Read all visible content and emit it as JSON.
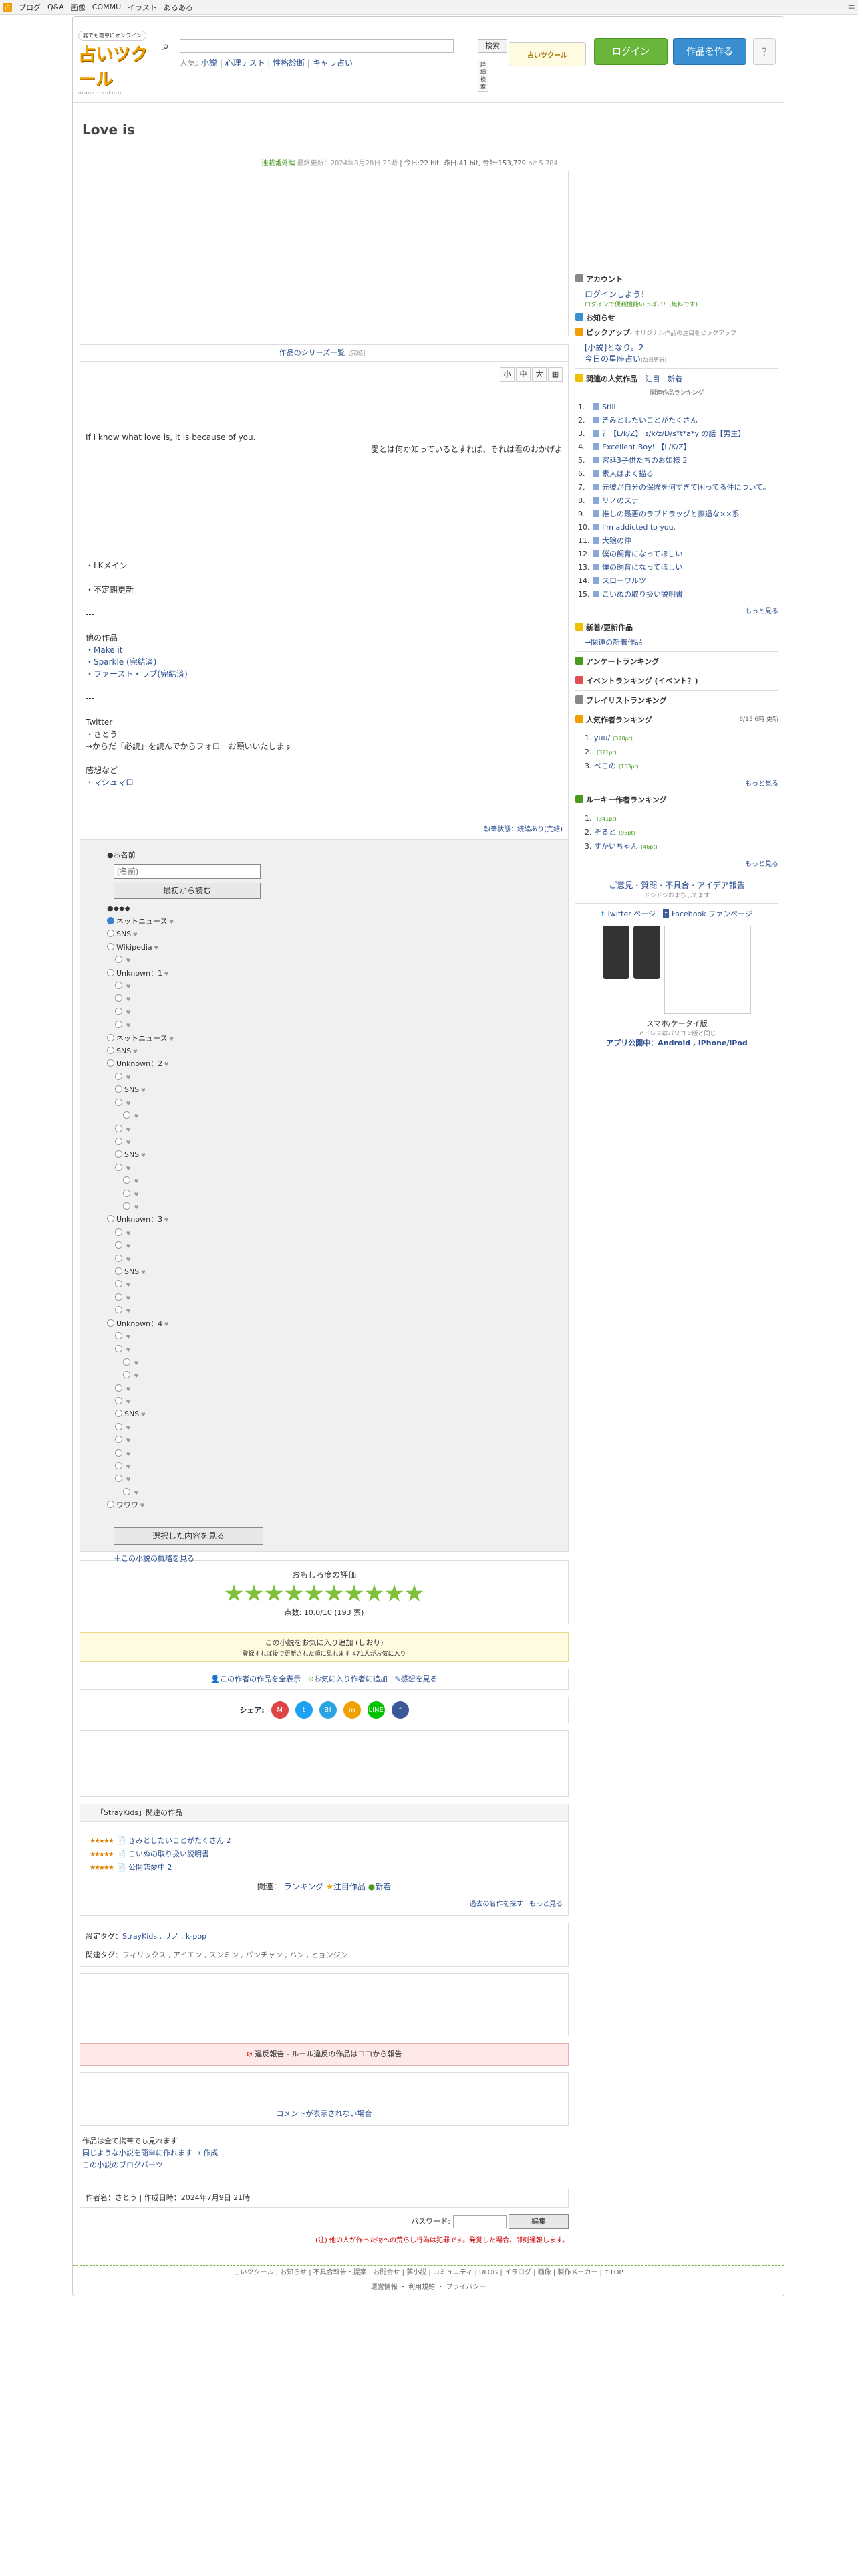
{
  "topnav": {
    "items": [
      "ブログ",
      "Q&A",
      "画像",
      "COMMU",
      "イラスト",
      "あるある"
    ]
  },
  "header": {
    "tag": "誰でも簡単にオンライン",
    "name": "占いツクール",
    "sub": "uranai-tsukuru",
    "search_btn": "検索",
    "popular_label": "人気:",
    "popular": [
      "小説",
      "心理テスト",
      "性格診断",
      "キャラ占い"
    ],
    "adv": "詳細検索",
    "banner": "占いツクール",
    "login": "ログイン",
    "create": "作品を作る"
  },
  "title": "Love is",
  "meta": {
    "status": "連載番外編",
    "updated": "最終更新：2024年8月28日 23時",
    "today": "今日:22 hit,",
    "yesterday": "昨日:41 hit,",
    "total": "合計:153,729 hit",
    "fav": "5 784"
  },
  "series_label": "作品のシリーズ一覧",
  "series_note": "［完結］",
  "font_sizes": [
    "小",
    "中",
    "大"
  ],
  "body_lines": [
    "If I know what love is, it is because of you.",
    "愛とは何か知っているとすれば、それは君のおかげよ",
    "---",
    "・LKメイン",
    "・不定期更新",
    "---",
    "他の作品",
    "・Make it",
    "・Sparkle (完結済)",
    "・ファースト・ラブ(完結済)",
    "---",
    "Twitter",
    "・さとう",
    "→からだ「必読」を読んでからフォローお願いいたします",
    "感想など",
    "・マシュマロ"
  ],
  "body_foot": "執筆状態：続編あり(完結)",
  "game": {
    "name_label": "●お名前",
    "name_ph": "(名前)",
    "read_first": "最初から読む",
    "tree_label": "●◆◆◆",
    "select_btn": "選択した内容を見る",
    "overview": "＋この小説の概略を見る",
    "tree": [
      {
        "d": 0,
        "t": "ネットニュース",
        "s": 1
      },
      {
        "d": 0,
        "t": "SNS"
      },
      {
        "d": 0,
        "t": "Wikipedia"
      },
      {
        "d": 1,
        "t": ""
      },
      {
        "d": 0,
        "t": "Unknown：1"
      },
      {
        "d": 1,
        "t": ""
      },
      {
        "d": 1,
        "t": ""
      },
      {
        "d": 1,
        "t": ""
      },
      {
        "d": 1,
        "t": ""
      },
      {
        "d": 0,
        "t": "ネットニュース"
      },
      {
        "d": 0,
        "t": "SNS"
      },
      {
        "d": 0,
        "t": "Unknown：2"
      },
      {
        "d": 1,
        "t": ""
      },
      {
        "d": 1,
        "t": "SNS"
      },
      {
        "d": 1,
        "t": ""
      },
      {
        "d": 2,
        "t": ""
      },
      {
        "d": 1,
        "t": ""
      },
      {
        "d": 1,
        "t": ""
      },
      {
        "d": 1,
        "t": "SNS"
      },
      {
        "d": 1,
        "t": ""
      },
      {
        "d": 2,
        "t": ""
      },
      {
        "d": 2,
        "t": ""
      },
      {
        "d": 2,
        "t": ""
      },
      {
        "d": 0,
        "t": "Unknown：3"
      },
      {
        "d": 1,
        "t": ""
      },
      {
        "d": 1,
        "t": ""
      },
      {
        "d": 1,
        "t": ""
      },
      {
        "d": 1,
        "t": "SNS"
      },
      {
        "d": 1,
        "t": ""
      },
      {
        "d": 1,
        "t": ""
      },
      {
        "d": 1,
        "t": ""
      },
      {
        "d": 0,
        "t": "Unknown：4"
      },
      {
        "d": 1,
        "t": ""
      },
      {
        "d": 1,
        "t": ""
      },
      {
        "d": 2,
        "t": ""
      },
      {
        "d": 2,
        "t": ""
      },
      {
        "d": 1,
        "t": ""
      },
      {
        "d": 1,
        "t": ""
      },
      {
        "d": 1,
        "t": "SNS"
      },
      {
        "d": 1,
        "t": ""
      },
      {
        "d": 1,
        "t": ""
      },
      {
        "d": 1,
        "t": ""
      },
      {
        "d": 1,
        "t": ""
      },
      {
        "d": 1,
        "t": ""
      },
      {
        "d": 2,
        "t": ""
      },
      {
        "d": 0,
        "t": "ワワワ"
      }
    ]
  },
  "rating": {
    "label": "おもしろ度の評価",
    "score": "点数: 10.0/10 (193 票)",
    "value": 10
  },
  "fav": {
    "line1": "この小説をお気に入り追加 (しおり)",
    "line2": "登録すれば後で更新された順に見れます 471人がお気に入り"
  },
  "actions": [
    "この作者の作品を全表示",
    "お気に入り作者に追加",
    "感想を見る"
  ],
  "share": {
    "label": "シェア:",
    "items": [
      {
        "t": "M",
        "c": "#d44"
      },
      {
        "t": "t",
        "c": "#1da1f2"
      },
      {
        "t": "B!",
        "c": "#2aa3e0"
      },
      {
        "t": "m",
        "c": "#f0a000"
      },
      {
        "t": "LINE",
        "c": "#00c300"
      },
      {
        "t": "f",
        "c": "#3b5998"
      }
    ]
  },
  "related": {
    "header": "「StrayKids」関連の作品",
    "items": [
      "きみとしたいことがたくさん 2",
      "こいぬの取り扱い説明書",
      "公開恋愛中 2"
    ],
    "links": [
      "ランキング",
      "注目作品",
      "新着"
    ],
    "past": "過去の名作を探す",
    "more": "もっと見る"
  },
  "tags": {
    "set_label": "設定タグ：",
    "set": "StrayKids , リノ , k-pop",
    "rel_label": "関連タグ：",
    "rel": "フィリックス , アイエン , スンミン , バンチャン , ハン , ヒョンジン"
  },
  "report": "違反報告 - ルール違反の作品はココから報告",
  "comment": "コメントが表示されない場合",
  "links": [
    "作品は全て携帯でも見れます",
    "同じような小説を簡単に作れます → 作成",
    "この小説のブログパーツ"
  ],
  "author": "作者名：さとう | 作成日時：2024年7月9日 21時",
  "password": {
    "label": "パスワード:",
    "btn": "編集"
  },
  "warning": "(注) 他の人が作った物への荒らし行為は犯罪です。発覚した場合、即刻通報します。",
  "sidebar": {
    "account": "アカウント",
    "login_msg": "ログインしよう！",
    "login_sub": "ログインで便利機能いっぱい！(無料です)",
    "notice": "お知らせ",
    "pickup": "ピックアップ",
    "pickup_sub": "- オリジナル作品の注目をピックアップ",
    "pickup_item": "[小説]となり。2",
    "pickup_item2": "今日の星座占い",
    "pickup_item2_sub": "(毎日更新)",
    "popular_title": "関連の人気作品",
    "tabs": [
      "注目",
      "新着"
    ],
    "ranking_title": "関連作品ランキング",
    "ranking": [
      "Still",
      "きみとしたいことがたくさん",
      "？【L/k/Z】 s/k/z/D/s*t*a*y の話【男主】",
      "Excellent Boy! 【L/K/Z】",
      "宮廷3子供たちのお姫様 2",
      "素人はよく描る",
      "元彼が自分の保険を何すぎて困ってる件について。",
      "リノのステ",
      "推しの最悪のラブドラッグと擦過な××系",
      "I'm addicted to you.",
      "犬狼の仲",
      "僕の飼育になってほしい",
      "僕の飼育になってほしい",
      "スローワルツ",
      "こいぬの取り扱い説明書"
    ],
    "more": "もっと見る",
    "new": "新着/更新作品",
    "new_sub": "→関連の新着作品",
    "enq": "アンケートランキング",
    "event": "イベントランキング (イベント？)",
    "playlist": "プレイリストランキング",
    "author_rank": "人気作者ランキング",
    "author_date": "6/15 6時 更新",
    "authors": [
      "yuu/",
      "",
      "べこの"
    ],
    "author_vals": [
      "(378pt)",
      "(321pt)",
      "(153pt)"
    ],
    "rookie": "ルーキー作者ランキング",
    "rookies": [
      "",
      "そると",
      "すかいちゃん"
    ],
    "rookie_vals": [
      "(341pt)",
      "(98pt)",
      "(46pt)"
    ],
    "feedback": "ご意見・質問・不具合・アイデア報告",
    "feedback_sub": "ドシドシおまちしてます",
    "twitter": "Twitter ページ",
    "facebook": "Facebook ファンページ",
    "mobile": "スマホ/ケータイ版",
    "mobile_sub": "アドレスはパソコン版と同じ",
    "app": "アプリ公開中：Android , iPhone/iPod"
  },
  "footer": {
    "row1": "占いツクール | お知らせ | 不具合報告・提案 | お問合せ | 夢小説 | コミュニティ | ULOG | イラログ | 画像 | 製作メーカー | ↑TOP",
    "row2": "運営情報 ・ 利用規約 ・ プライバシー"
  }
}
